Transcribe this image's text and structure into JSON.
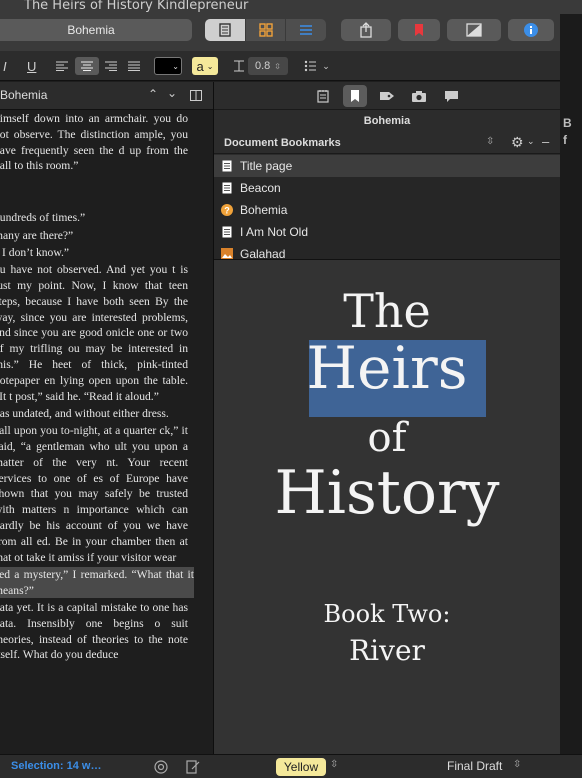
{
  "window": {
    "title": "The Heirs of History Kindlepreneur"
  },
  "toolbar": {
    "document_name": "Bohemia",
    "view_modes": [
      "document-icon",
      "corkboard-icon",
      "outline-icon"
    ],
    "buttons": [
      "share-icon",
      "bookmark-icon",
      "quicklook-icon",
      "info-icon"
    ]
  },
  "formatbar": {
    "italic": "I",
    "underline": "U",
    "highlight_letter": "a",
    "line_spacing": "0.8",
    "list_icon": "list-icon"
  },
  "editor": {
    "header_title": "Bohemia",
    "paragraphs": [
      "himself down into an armchair. you do not observe. The distinction ample, you have frequently seen the d up from the hall to this room.”",
      "’",
      "”",
      "hundreds of times.”",
      "many are there?”",
      "” I don’t know.”",
      "ou have not observed. And yet you t is just my point. Now, I know that teen steps, because I have both seen By the way, since you are interested problems, and since you are good onicle one or two of my trifling ou may be interested in this.” He heet of thick, pink-tinted notepaper en lying open upon the table. “It t post,” said he. “Read it aloud.”",
      "vas undated, and without either dress.",
      "call upon you to-night, at a quarter ck,” it said, “a gentleman who ult you upon a matter of the very nt. Your recent services to one of es of Europe have shown that you may safely be trusted with matters n importance which can hardly be his account of you we have from all ed. Be in your chamber then at that ot take it amiss if your visitor wear",
      "eed a mystery,” I remarked. “What that it means?”",
      "data yet. It is a capital mistake to one has data. Insensibly one begins o suit theories, instead of theories to the note itself. What do you deduce"
    ]
  },
  "inspector": {
    "title": "Bohemia",
    "section_title": "Document Bookmarks",
    "bookmarks": [
      {
        "label": "Title page",
        "icon": "document-icon"
      },
      {
        "label": "Beacon",
        "icon": "document-icon"
      },
      {
        "label": "Bohemia",
        "icon": "question-icon"
      },
      {
        "label": "I Am Not Old",
        "icon": "document-icon"
      },
      {
        "label": "Galahad",
        "icon": "image-icon"
      }
    ]
  },
  "preview": {
    "line1": "The",
    "line2": "Heirs",
    "line3": "of",
    "line4": "History",
    "line5": "Book Two:",
    "line6": "River"
  },
  "edge": {
    "bohemia_fragment": "B",
    "f_fragment": "f"
  },
  "status": {
    "selection": "Selection: 14 w…",
    "label": "Yellow",
    "status": "Final Draft"
  },
  "colors": {
    "accent": "#3b8ee8",
    "highlight_yellow": "#f4e89a",
    "bookmark_red": "#e8383d",
    "selection_blue": "#3f6496"
  }
}
